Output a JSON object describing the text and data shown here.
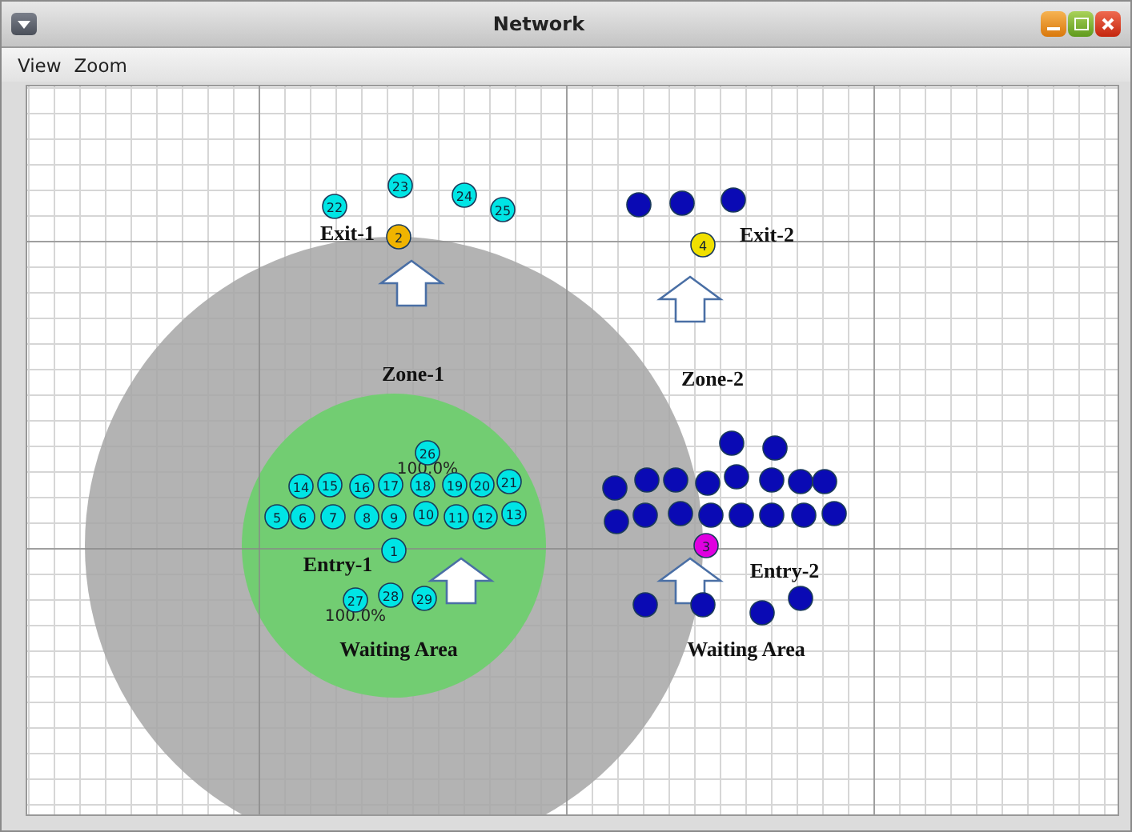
{
  "window": {
    "title": "Network"
  },
  "menu": [
    {
      "label": "View"
    },
    {
      "label": "Zoom"
    }
  ],
  "zones": [
    {
      "label": "Zone-1"
    },
    {
      "label": "Zone-2"
    }
  ],
  "places": [
    {
      "label": "Exit-1"
    },
    {
      "label": "Exit-2"
    },
    {
      "label": "Entry-1"
    },
    {
      "label": "Entry-2"
    },
    {
      "label": "Waiting Area"
    },
    {
      "label": "Waiting Area"
    }
  ],
  "readings": [
    {
      "text": "100.0%"
    },
    {
      "text": "100.0%"
    }
  ],
  "nodes": [
    {
      "label": "1",
      "color": "#00e5e5"
    },
    {
      "label": "2",
      "color": "#f0b400"
    },
    {
      "label": "3",
      "color": "#e000e0"
    },
    {
      "label": "4",
      "color": "#f0e000"
    },
    {
      "label": "5",
      "color": "#00e5e5"
    },
    {
      "label": "6",
      "color": "#00e5e5"
    },
    {
      "label": "7",
      "color": "#00e5e5"
    },
    {
      "label": "8",
      "color": "#00e5e5"
    },
    {
      "label": "9",
      "color": "#00e5e5"
    },
    {
      "label": "10",
      "color": "#00e5e5"
    },
    {
      "label": "11",
      "color": "#00e5e5"
    },
    {
      "label": "12",
      "color": "#00e5e5"
    },
    {
      "label": "13",
      "color": "#00e5e5"
    },
    {
      "label": "14",
      "color": "#00e5e5"
    },
    {
      "label": "15",
      "color": "#00e5e5"
    },
    {
      "label": "16",
      "color": "#00e5e5"
    },
    {
      "label": "17",
      "color": "#00e5e5"
    },
    {
      "label": "18",
      "color": "#00e5e5"
    },
    {
      "label": "19",
      "color": "#00e5e5"
    },
    {
      "label": "20",
      "color": "#00e5e5"
    },
    {
      "label": "21",
      "color": "#00e5e5"
    },
    {
      "label": "22",
      "color": "#00e5e5"
    },
    {
      "label": "23",
      "color": "#00e5e5"
    },
    {
      "label": "24",
      "color": "#00e5e5"
    },
    {
      "label": "25",
      "color": "#00e5e5"
    },
    {
      "label": "26",
      "color": "#00e5e5"
    },
    {
      "label": "27",
      "color": "#00e5e5"
    },
    {
      "label": "28",
      "color": "#00e5e5"
    },
    {
      "label": "29",
      "color": "#00e5e5"
    },
    {
      "color": "#0a0ab4"
    },
    {
      "color": "#0a0ab4"
    },
    {
      "color": "#0a0ab4"
    },
    {
      "color": "#0a0ab4"
    },
    {
      "color": "#0a0ab4"
    },
    {
      "color": "#0a0ab4"
    },
    {
      "color": "#0a0ab4"
    },
    {
      "color": "#0a0ab4"
    },
    {
      "color": "#0a0ab4"
    },
    {
      "color": "#0a0ab4"
    },
    {
      "color": "#0a0ab4"
    },
    {
      "color": "#0a0ab4"
    },
    {
      "color": "#0a0ab4"
    },
    {
      "color": "#0a0ab4"
    },
    {
      "color": "#0a0ab4"
    },
    {
      "color": "#0a0ab4"
    },
    {
      "color": "#0a0ab4"
    },
    {
      "color": "#0a0ab4"
    },
    {
      "color": "#0a0ab4"
    },
    {
      "color": "#0a0ab4"
    },
    {
      "color": "#0a0ab4"
    },
    {
      "color": "#0a0ab4"
    },
    {
      "color": "#0a0ab4"
    },
    {
      "color": "#0a0ab4"
    },
    {
      "color": "#0a0ab4"
    }
  ]
}
